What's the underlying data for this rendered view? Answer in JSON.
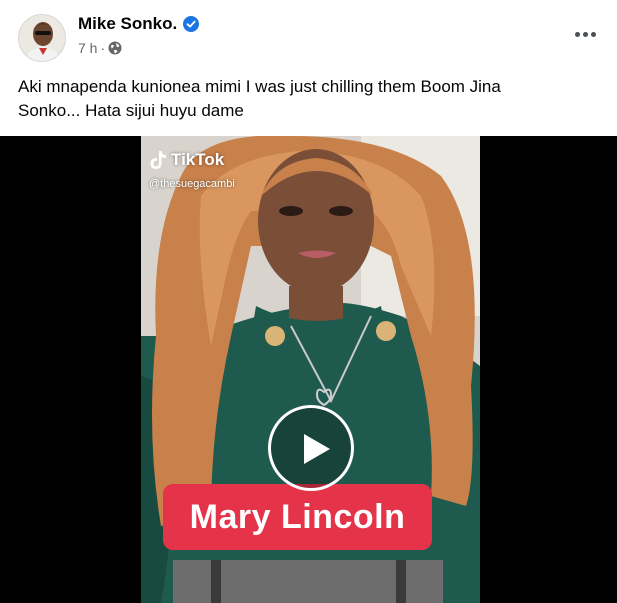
{
  "post": {
    "author": "Mike Sonko.",
    "time": "7 h",
    "separator": "·",
    "text_line1": "Aki mnapenda  kunionea mimi I was just chilling them Boom Jina",
    "text_line2": "Sonko... Hata sijui huyu dame"
  },
  "video": {
    "platform": "TikTok",
    "handle": "@thesuegacambi",
    "caption": "Mary Lincoln"
  },
  "icons": {
    "verified": "verified-badge-icon",
    "audience": "globe-icon",
    "more": "more-options-icon",
    "play": "play-icon"
  },
  "colors": {
    "verified_blue": "#1b74e4",
    "caption_red": "#e53349",
    "meta_gray": "#65676b"
  }
}
